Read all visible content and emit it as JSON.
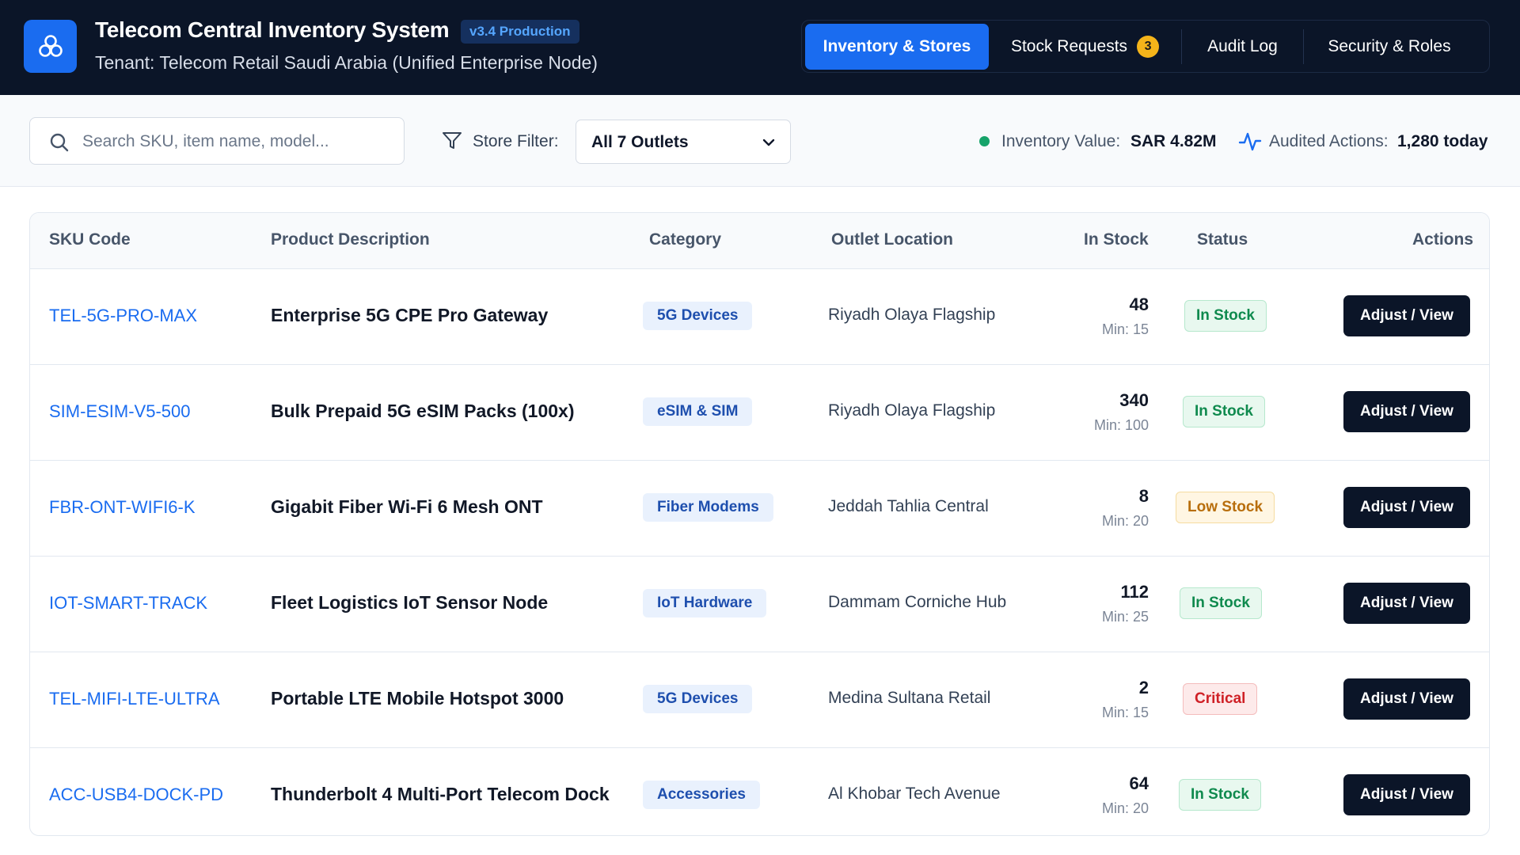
{
  "app": {
    "title": "Telecom Central Inventory System",
    "version": "v3.4 Production",
    "tenant": "Tenant: Telecom Retail Saudi Arabia (Unified Enterprise Node)",
    "logo_icon": "network-nodes-icon"
  },
  "nav": {
    "items": [
      {
        "label": "Inventory & Stores",
        "active": true
      },
      {
        "label": "Stock Requests",
        "badge": "3"
      },
      {
        "label": "Audit Log"
      },
      {
        "label": "Security & Roles"
      }
    ]
  },
  "toolbar": {
    "search_placeholder": "Search SKU, item name, model...",
    "search_value": "",
    "filter_label": "Store Filter:",
    "filter_selected": "All 7 Outlets",
    "inventory_label": "Inventory Value:",
    "inventory_value": "SAR 4.82M",
    "audited_label": "Audited Actions:",
    "audited_value": "1,280 today"
  },
  "table": {
    "headers": {
      "sku": "SKU Code",
      "description": "Product Description",
      "category": "Category",
      "location": "Outlet Location",
      "stock": "In Stock",
      "status": "Status",
      "actions": "Actions"
    },
    "rows": [
      {
        "sku": "TEL-5G-PRO-MAX",
        "description": "Enterprise 5G CPE Pro Gateway",
        "category": "5G Devices",
        "location": "Riyadh Olaya Flagship",
        "stock": "48",
        "min": "Min: 15",
        "status": "In Stock",
        "status_type": "in",
        "action": "Adjust / View"
      },
      {
        "sku": "SIM-ESIM-V5-500",
        "description": "Bulk Prepaid 5G eSIM Packs (100x)",
        "category": "eSIM & SIM",
        "location": "Riyadh Olaya Flagship",
        "stock": "340",
        "min": "Min: 100",
        "status": "In Stock",
        "status_type": "in",
        "action": "Adjust / View"
      },
      {
        "sku": "FBR-ONT-WIFI6-K",
        "description": "Gigabit Fiber Wi-Fi 6 Mesh ONT",
        "category": "Fiber Modems",
        "location": "Jeddah Tahlia Central",
        "stock": "8",
        "min": "Min: 20",
        "status": "Low Stock",
        "status_type": "low",
        "action": "Adjust / View"
      },
      {
        "sku": "IOT-SMART-TRACK",
        "description": "Fleet Logistics IoT Sensor Node",
        "category": "IoT Hardware",
        "location": "Dammam Corniche Hub",
        "stock": "112",
        "min": "Min: 25",
        "status": "In Stock",
        "status_type": "in",
        "action": "Adjust / View"
      },
      {
        "sku": "TEL-MIFI-LTE-ULTRA",
        "description": "Portable LTE Mobile Hotspot 3000",
        "category": "5G Devices",
        "location": "Medina Sultana Retail",
        "stock": "2",
        "min": "Min: 15",
        "status": "Critical",
        "status_type": "crit",
        "action": "Adjust / View"
      },
      {
        "sku": "ACC-USB4-DOCK-PD",
        "description": "Thunderbolt 4 Multi-Port Telecom Dock",
        "category": "Accessories",
        "location": "Al Khobar Tech Avenue",
        "stock": "64",
        "min": "Min: 20",
        "status": "In Stock",
        "status_type": "in",
        "action": "Adjust / View"
      }
    ]
  },
  "colors": {
    "header_bg": "#0b1528",
    "accent": "#1a6cf0",
    "badge": "#f4b41a",
    "in_stock": "#0f8a4e",
    "low_stock": "#b86e0c",
    "critical": "#cf2026"
  }
}
